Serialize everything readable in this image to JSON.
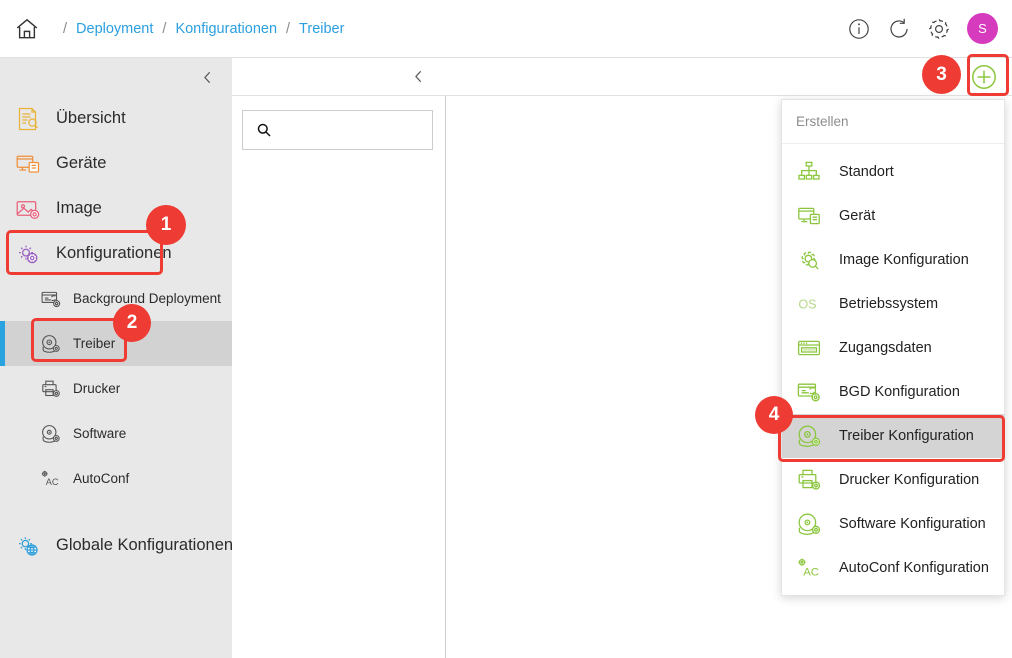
{
  "breadcrumb": {
    "home_icon": "home-icon",
    "items": [
      "Deployment",
      "Konfigurationen",
      "Treiber"
    ],
    "separator": "/"
  },
  "topbar": {
    "info_icon": "info-icon",
    "refresh_icon": "refresh-icon",
    "settings_icon": "gear-icon",
    "avatar_initial": "S",
    "avatar_color": "#d63bbe"
  },
  "sidebar": {
    "collapse_icon": "chevron-left-icon",
    "items": [
      {
        "label": "Übersicht",
        "icon": "overview-icon",
        "color": "#e8b23a"
      },
      {
        "label": "Geräte",
        "icon": "device-icon",
        "color": "#ef8f3b"
      },
      {
        "label": "Image",
        "icon": "image-icon",
        "color": "#e8607a"
      },
      {
        "label": "Konfigurationen",
        "icon": "configurations-gear-icon",
        "color": "#9b5fc0"
      }
    ],
    "subitems": [
      {
        "label": "Background Deployment",
        "icon": "background-deployment-icon",
        "color": "#555555",
        "active": false
      },
      {
        "label": "Treiber",
        "icon": "driver-disc-icon",
        "color": "#555555",
        "active": true
      },
      {
        "label": "Drucker",
        "icon": "printer-icon",
        "color": "#555555",
        "active": false
      },
      {
        "label": "Software",
        "icon": "software-disc-icon",
        "color": "#555555",
        "active": false
      },
      {
        "label": "AutoConf",
        "icon": "autoconf-icon",
        "color": "#555555",
        "active": false
      }
    ],
    "footer_item": {
      "label": "Globale Konfigurationen",
      "icon": "global-config-globe-icon",
      "color": "#2f9fd8"
    },
    "active_accent_color": "#29a3e0",
    "background_color": "#e8e8e8"
  },
  "subheader": {
    "back_icon": "chevron-left-icon",
    "add_button_icon": "plus-circle-icon",
    "add_button_color": "#8cc63f"
  },
  "search": {
    "icon": "search-icon",
    "value": "",
    "placeholder": ""
  },
  "dropdown": {
    "title": "Erstellen",
    "items": [
      {
        "label": "Standort",
        "icon": "sitemap-icon",
        "highlight": false
      },
      {
        "label": "Gerät",
        "icon": "device-icon",
        "highlight": false
      },
      {
        "label": "Image Konfiguration",
        "icon": "image-config-gear-icon",
        "highlight": false
      },
      {
        "label": "Betriebssystem",
        "icon": "os-text-icon",
        "highlight": false
      },
      {
        "label": "Zugangsdaten",
        "icon": "credentials-icon",
        "highlight": false
      },
      {
        "label": "BGD Konfiguration",
        "icon": "bgd-config-icon",
        "highlight": false
      },
      {
        "label": "Treiber Konfiguration",
        "icon": "driver-config-disc-icon",
        "highlight": true
      },
      {
        "label": "Drucker Konfiguration",
        "icon": "printer-config-icon",
        "highlight": false
      },
      {
        "label": "Software Konfiguration",
        "icon": "software-config-disc-icon",
        "highlight": false
      },
      {
        "label": "AutoConf Konfiguration",
        "icon": "autoconf-config-icon",
        "highlight": false
      }
    ],
    "icon_color": "#8cc63f"
  },
  "annotations": {
    "color": "#ee3b33",
    "badges": [
      {
        "number": "1",
        "target": "sidebar-item-konfigurationen"
      },
      {
        "number": "2",
        "target": "sidebar-subitem-treiber"
      },
      {
        "number": "3",
        "target": "add-button"
      },
      {
        "number": "4",
        "target": "dropdown-item-treiber-konfiguration"
      }
    ]
  }
}
